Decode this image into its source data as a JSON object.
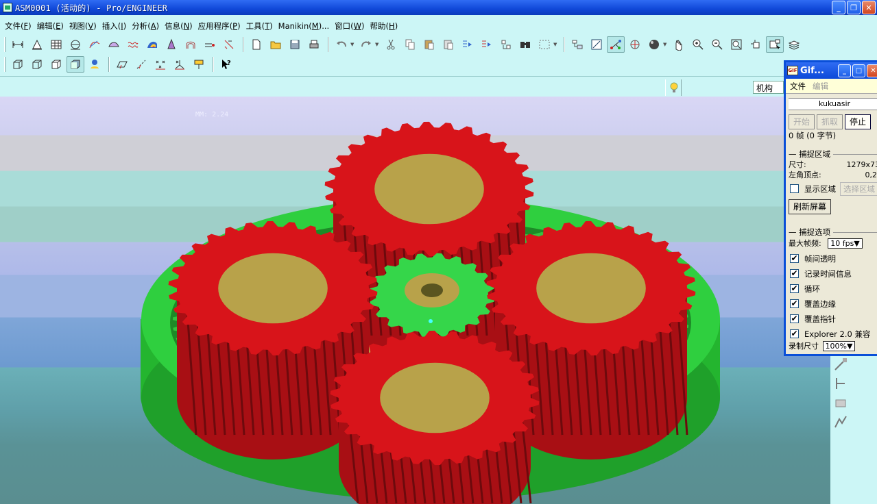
{
  "window": {
    "title": "ASM0001 (活动的) - Pro/ENGINEER",
    "minimize": "_",
    "maximize": "❐",
    "close": "✕"
  },
  "menu": [
    {
      "label": "文件",
      "key": "F"
    },
    {
      "label": "编辑",
      "key": "E"
    },
    {
      "label": "视图",
      "key": "V"
    },
    {
      "label": "插入",
      "key": "I"
    },
    {
      "label": "分析",
      "key": "A"
    },
    {
      "label": "信息",
      "key": "N"
    },
    {
      "label": "应用程序",
      "key": "P"
    },
    {
      "label": "工具",
      "key": "T"
    },
    {
      "label": "Manikin",
      "key": "M",
      "suffix": "..."
    },
    {
      "label": "窗口",
      "key": "W"
    },
    {
      "label": "帮助",
      "key": "H"
    }
  ],
  "mechanism_field": "机构",
  "viewport_label": "MM: 2.24",
  "colors": {
    "ring_gear": "#2fcf3f",
    "planet_gear": "#d8141a",
    "face": "#b8a24a",
    "sun_gear": "#35d64a",
    "title_blue": "#0c49d8"
  },
  "gif_dialog": {
    "title": "Gif...",
    "menu_file": "文件",
    "menu_edit": "编辑",
    "name": "kukuasir",
    "btn_start": "开始",
    "btn_capture": "抓取",
    "btn_stop": "停止",
    "frames_text": "0 帧 (0 字节)",
    "capture_area_title": "捕捉区域",
    "size_label": "尺寸:",
    "size_value": "1279x73",
    "topleft_label": "左角顶点:",
    "topleft_value": "0,2",
    "show_area": "显示区域",
    "select_area": "选择区域",
    "refresh": "刷新屏幕",
    "options_title": "捕捉选项",
    "max_fps_label": "最大帧频:",
    "max_fps_value": "10 fps▼",
    "options": [
      {
        "label": "帧间透明",
        "checked": "✔"
      },
      {
        "label": "记录时间信息",
        "checked": "✔"
      },
      {
        "label": "循环",
        "checked": "✔"
      },
      {
        "label": "覆盖边缘",
        "checked": "✔"
      },
      {
        "label": "覆盖指针",
        "checked": "✔"
      },
      {
        "label": "Explorer 2.0 兼容",
        "checked": "✔"
      }
    ],
    "rec_size_label": "录制尺寸",
    "rec_size_value": "100%▼"
  }
}
